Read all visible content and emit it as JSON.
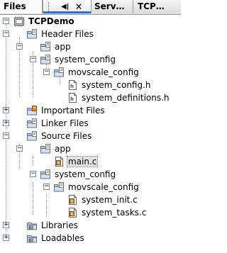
{
  "tabs": {
    "files": "Files",
    "serv": "Serv…",
    "tcp": "TCP…",
    "minimize_glyph": "◀|",
    "close_glyph": "×"
  },
  "tree": {
    "project": "TCPDemo",
    "header_files": "Header Files",
    "hf_app": "app",
    "hf_system_config": "system_config",
    "hf_movscale_config": "movscale_config",
    "hf_system_config_h": "system_config.h",
    "hf_system_definitions_h": "system_definitions.h",
    "important_files": "Important Files",
    "linker_files": "Linker Files",
    "source_files": "Source Files",
    "sf_app": "app",
    "sf_main_c": "main.c",
    "sf_system_config": "system_config",
    "sf_movscale_config": "movscale_config",
    "sf_system_init_c": "system_init.c",
    "sf_system_tasks_c": "system_tasks.c",
    "libraries": "Libraries",
    "loadables": "Loadables"
  },
  "colors": {
    "folder": "#8a9fb8",
    "folder_light": "#c9d6e6",
    "tab_accent": "#3a70c2",
    "c_file": "#d9822b"
  }
}
